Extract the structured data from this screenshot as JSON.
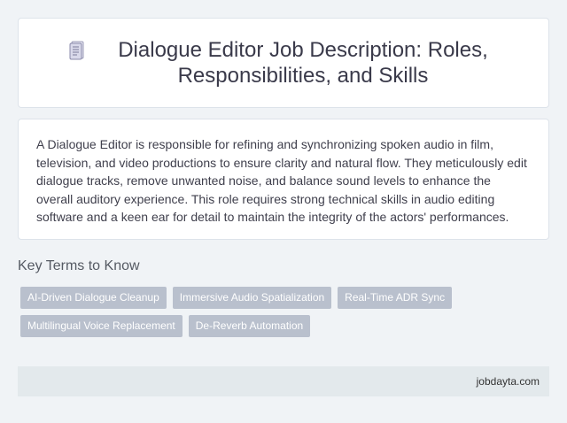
{
  "header": {
    "icon": "document-icon",
    "title": "Dialogue Editor Job Description: Roles, Responsibilities, and Skills"
  },
  "description": {
    "text": "A Dialogue Editor is responsible for refining and synchronizing spoken audio in film, television, and video productions to ensure clarity and natural flow. They meticulously edit dialogue tracks, remove unwanted noise, and balance sound levels to enhance the overall auditory experience. This role requires strong technical skills in audio editing software and a keen ear for detail to maintain the integrity of the actors' performances."
  },
  "key_terms": {
    "heading": "Key Terms to Know",
    "tags": [
      "AI-Driven Dialogue Cleanup",
      "Immersive Audio Spatialization",
      "Real-Time ADR Sync",
      "Multilingual Voice Replacement",
      "De-Reverb Automation"
    ]
  },
  "footer": {
    "site": "jobdayta.com"
  },
  "colors": {
    "background": "#f0f3f6",
    "card": "#ffffff",
    "tag": "#b9c0cd",
    "footer": "#e3e9ec"
  }
}
